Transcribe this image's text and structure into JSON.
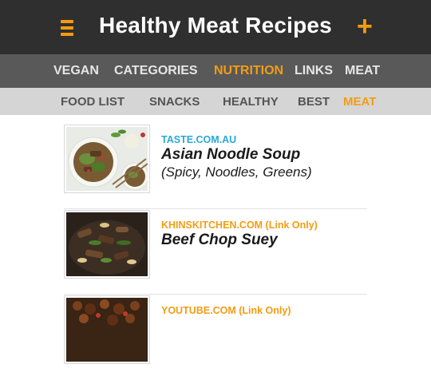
{
  "header": {
    "title": "Healthy Meat Recipes",
    "menu_icon": "hamburger-menu-icon",
    "add_label": "+"
  },
  "nav_primary": {
    "items": [
      {
        "label": "VEGAN"
      },
      {
        "label": "CATEGORIES"
      },
      {
        "label": "NUTRITION",
        "active": true
      },
      {
        "label": "LINKS"
      },
      {
        "label": "MEAT"
      }
    ]
  },
  "nav_secondary": {
    "items": [
      {
        "label": "FOOD LIST"
      },
      {
        "label": "SNACKS"
      },
      {
        "label": "HEALTHY"
      },
      {
        "label": "BEST"
      },
      {
        "label": "MEAT",
        "active": true
      }
    ]
  },
  "recipes": [
    {
      "source": "TASTE.COM.AU",
      "source_color": "#29a8d6",
      "title": "Asian Noodle Soup",
      "subtitle": "(Spicy, Noodles, Greens)"
    },
    {
      "source": "KHINSKITCHEN.COM (Link Only)",
      "source_color": "#f39c12",
      "title": "Beef Chop Suey",
      "subtitle": ""
    },
    {
      "source": "YOUTUBE.COM (Link Only)",
      "source_color": "#f39c12",
      "title": "",
      "subtitle": ""
    }
  ],
  "colors": {
    "accent": "#f39c12",
    "header_bg": "#2f2f2f",
    "nav_primary_bg": "#595959",
    "nav_secondary_bg": "#d5d5d5"
  }
}
